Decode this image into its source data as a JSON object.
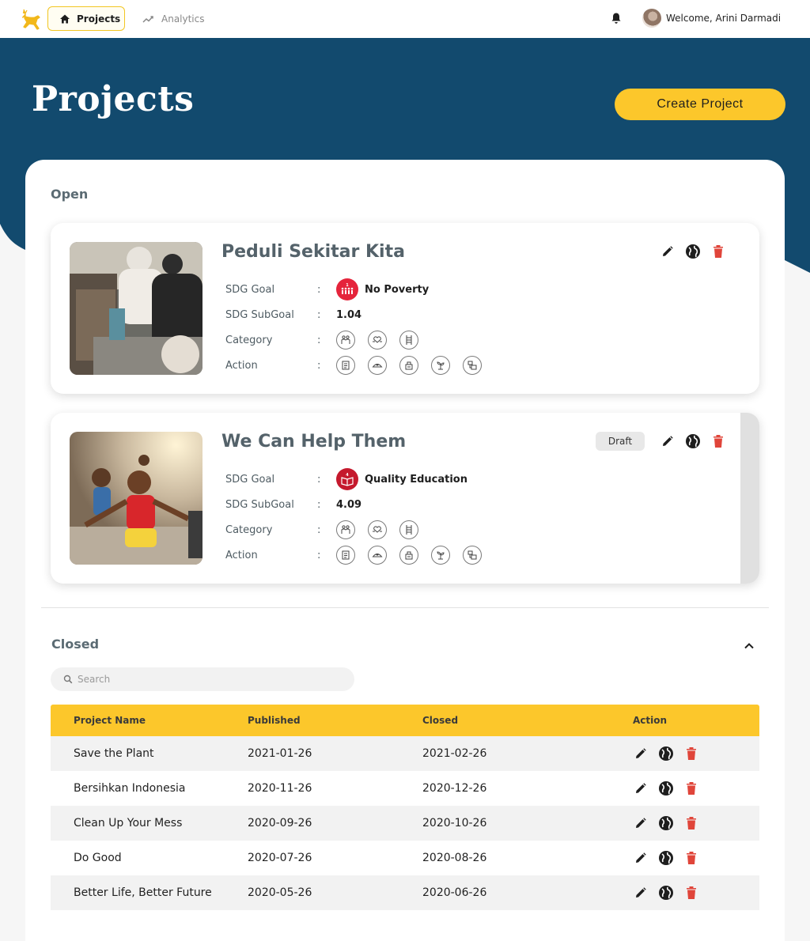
{
  "nav": {
    "projects_label": "Projects",
    "analytics_label": "Analytics",
    "welcome_text": "Welcome, Arini Darmadi"
  },
  "header": {
    "title": "Projects",
    "create_button": "Create Project"
  },
  "open_section": {
    "title": "Open",
    "field_labels": {
      "sdg_goal": "SDG Goal",
      "sdg_subgoal": "SDG SubGoal",
      "category": "Category",
      "action": "Action"
    },
    "projects": [
      {
        "name": "Peduli Sekitar Kita",
        "sdg_goal": "No Poverty",
        "sdg_number": "1",
        "sdg_color": "#e5243b",
        "sdg_subgoal": "1.04",
        "status_badge": "",
        "category_icons": [
          "people-icon",
          "heart-hand-icon",
          "ladder-icon"
        ],
        "action_icons": [
          "document-icon",
          "nurse-cap-icon",
          "donation-icon",
          "plant-icon",
          "tools-icon"
        ]
      },
      {
        "name": "We Can Help Them",
        "sdg_goal": "Quality Education",
        "sdg_number": "4",
        "sdg_color": "#c5192d",
        "sdg_subgoal": "4.09",
        "status_badge": "Draft",
        "category_icons": [
          "people-icon",
          "heart-hand-icon",
          "ladder-icon"
        ],
        "action_icons": [
          "document-icon",
          "nurse-cap-icon",
          "donation-icon",
          "plant-icon",
          "tools-icon"
        ]
      }
    ]
  },
  "closed_section": {
    "title": "Closed",
    "search_placeholder": "Search",
    "columns": [
      "Project Name",
      "Published",
      "Closed",
      "Action"
    ],
    "rows": [
      {
        "name": "Save the Plant",
        "published": "2021-01-26",
        "closed": "2021-02-26"
      },
      {
        "name": "Bersihkan Indonesia",
        "published": "2020-11-26",
        "closed": "2020-12-26"
      },
      {
        "name": "Clean Up Your Mess",
        "published": "2020-09-26",
        "closed": "2020-10-26"
      },
      {
        "name": "Do Good",
        "published": "2020-07-26",
        "closed": "2020-08-26"
      },
      {
        "name": "Better Life, Better Future",
        "published": "2020-05-26",
        "closed": "2020-06-26"
      }
    ]
  },
  "colors": {
    "navy": "#124a6e",
    "accent_yellow": "#fcc72b",
    "delete_red": "#e0453a"
  }
}
